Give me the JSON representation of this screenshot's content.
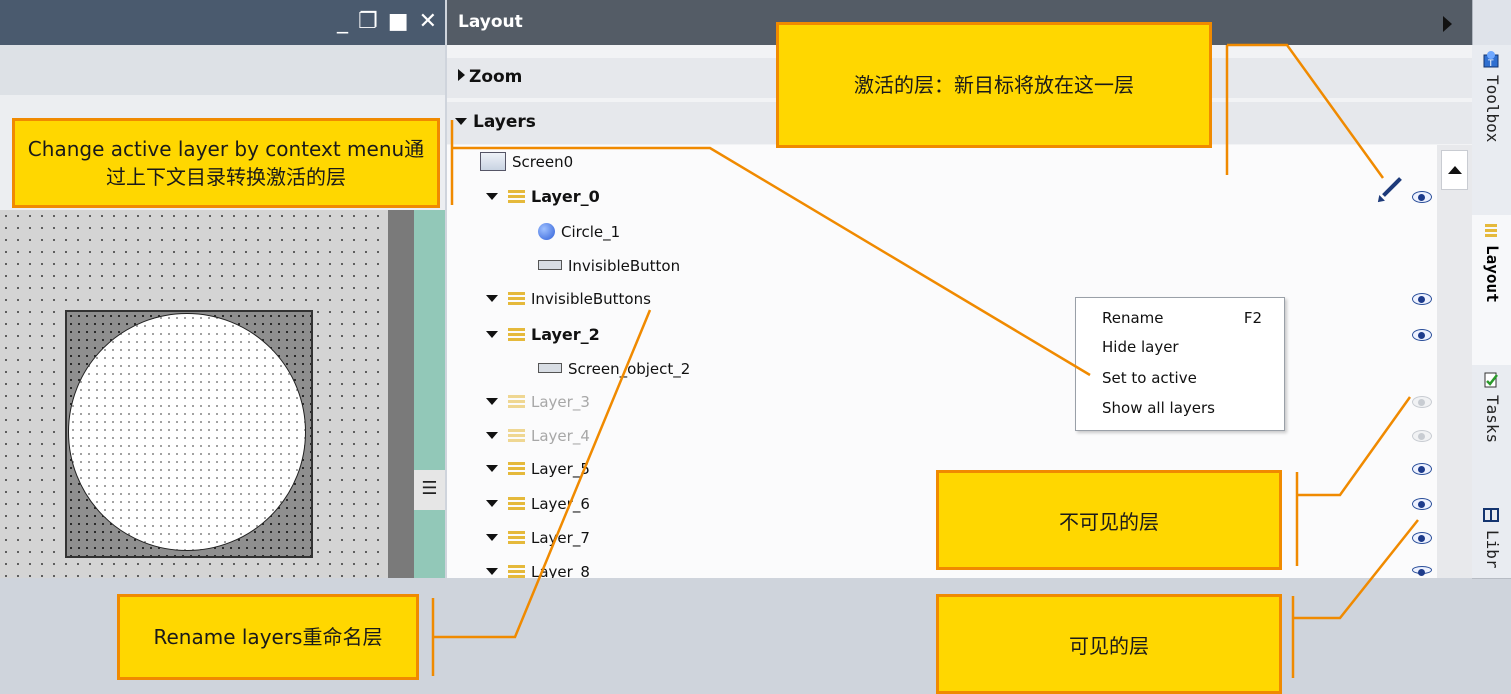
{
  "window": {
    "controls": [
      "_",
      "❐",
      "■",
      "✕"
    ]
  },
  "layout_panel": {
    "title": "Layout",
    "sections": {
      "zoom": "Zoom",
      "layers": "Layers"
    },
    "tree": [
      {
        "label": "Screen0",
        "type": "screen"
      },
      {
        "label": "Layer_0",
        "type": "layer",
        "bold": true,
        "active": true,
        "visible": true
      },
      {
        "label": "Circle_1",
        "type": "circle"
      },
      {
        "label": "InvisibleButton",
        "type": "button"
      },
      {
        "label": "InvisibleButtons",
        "type": "layer",
        "visible": true
      },
      {
        "label": "Layer_2",
        "type": "layer",
        "bold": true,
        "visible": true
      },
      {
        "label": "Screen_object_2",
        "type": "button"
      },
      {
        "label": "Layer_3",
        "type": "layer",
        "dim": true,
        "visible": false
      },
      {
        "label": "Layer_4",
        "type": "layer",
        "dim": true,
        "visible": false
      },
      {
        "label": "Layer_5",
        "type": "layer",
        "visible": true
      },
      {
        "label": "Layer_6",
        "type": "layer",
        "visible": true
      },
      {
        "label": "Layer_7",
        "type": "layer",
        "visible": true
      },
      {
        "label": "Layer_8",
        "type": "layer",
        "visible": true
      }
    ]
  },
  "context_menu": {
    "rename": "Rename",
    "rename_shortcut": "F2",
    "hide_layer": "Hide layer",
    "set_to_active": "Set to active",
    "show_all_layers": "Show all layers"
  },
  "side_tabs": {
    "toolbox": "Toolbox",
    "layout": "Layout",
    "tasks": "Tasks",
    "libraries": "Libr"
  },
  "callouts": {
    "active_layer": "激活的层：新目标将放在这一层",
    "change_active": "Change active layer by context menu通过上下文目录转换激活的层",
    "rename_layers": "Rename layers重命名层",
    "invisible_layer": "不可见的层",
    "visible_layer": "可见的层"
  },
  "colors": {
    "callout_fill": "#ffd700",
    "callout_border": "#f08a00",
    "panel_header": "#545c66",
    "eye_visible": "#2b4f9a"
  }
}
